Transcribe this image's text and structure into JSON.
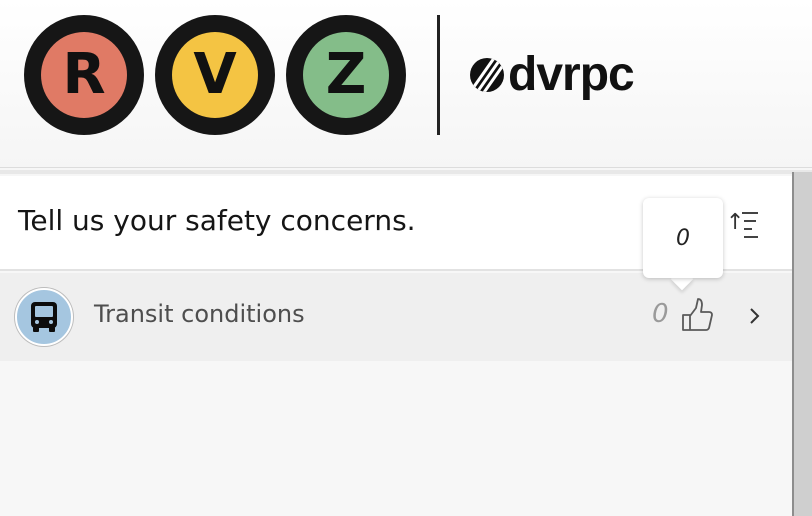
{
  "header": {
    "badges": [
      {
        "letter": "R",
        "color": "#e07a65"
      },
      {
        "letter": "V",
        "color": "#f4c443"
      },
      {
        "letter": "Z",
        "color": "#84bd89"
      }
    ],
    "org_logo_text": "dvrpc"
  },
  "panel": {
    "title": "Tell us your safety concerns.",
    "sort_icon": "sort-ascending-icon",
    "tooltip_value": "0",
    "items": [
      {
        "label": "Transit conditions",
        "icon": "bus-icon",
        "avatar_color": "#a5c6e0",
        "vote_count": "0",
        "like_icon": "thumbs-up-icon",
        "chevron_icon": "chevron-right-icon"
      }
    ]
  }
}
